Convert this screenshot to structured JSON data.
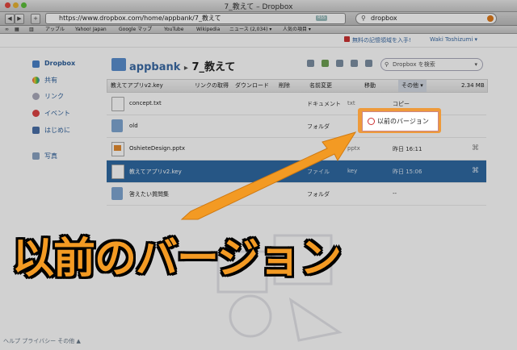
{
  "window": {
    "title": "7_教えて – Dropbox"
  },
  "toolbar": {
    "url": "https://www.dropbox.com/home/appbank/7_教えて",
    "rss": "RSS",
    "search_value": "dropbox"
  },
  "bookmarks": [
    "アップル",
    "Yahoo! Japan",
    "Google マップ",
    "YouTube",
    "Wikipedia",
    "ニュース (2,034) ▾",
    "人気の項目 ▾"
  ],
  "header": {
    "promo": "無料の記憶領域を入手!",
    "user": "Waki Toshizumi ▾"
  },
  "sidebar": {
    "items": [
      {
        "label": "Dropbox"
      },
      {
        "label": "共有"
      },
      {
        "label": "リンク"
      },
      {
        "label": "イベント"
      },
      {
        "label": "はじめに"
      },
      {
        "label": "写真"
      }
    ]
  },
  "breadcrumb": {
    "parent": "appbank",
    "sep": "▸",
    "current": "7_教えて"
  },
  "dbsearch": {
    "placeholder": "Dropbox を検索"
  },
  "actions": {
    "file": "教えてアプリv2.key",
    "link": "リンクの取得",
    "download": "ダウンロード",
    "delete": "削除",
    "rename": "名前変更",
    "move": "移動",
    "more": "その他 ▾",
    "size": "2.34 MB"
  },
  "files": [
    {
      "name": "concept.txt",
      "kind": "ドキュメント",
      "ext": "txt",
      "modified": "",
      "icon": "doc"
    },
    {
      "name": "old",
      "kind": "フォルダ",
      "ext": "",
      "modified": "",
      "icon": "folder"
    },
    {
      "name": "OshieteDesign.pptx",
      "kind": "",
      "ext": "pptx",
      "modified": "昨日 16:11",
      "icon": "ppt"
    },
    {
      "name": "教えてアプリv2.key",
      "kind": "ファイル",
      "ext": "key",
      "modified": "昨日 15:06",
      "icon": "doc"
    },
    {
      "name": "答えたい質問集",
      "kind": "フォルダ",
      "ext": "",
      "modified": "--",
      "icon": "folder"
    }
  ],
  "menu": {
    "copy": "コピー",
    "version_history": "以前のバージョン"
  },
  "caption": "以前のバージョン",
  "footer": "ヘルプ プライバシー その他 ▲",
  "colors": {
    "accent": "#f39a23",
    "selection": "#2f6aa3",
    "link": "#3b6ba5"
  }
}
